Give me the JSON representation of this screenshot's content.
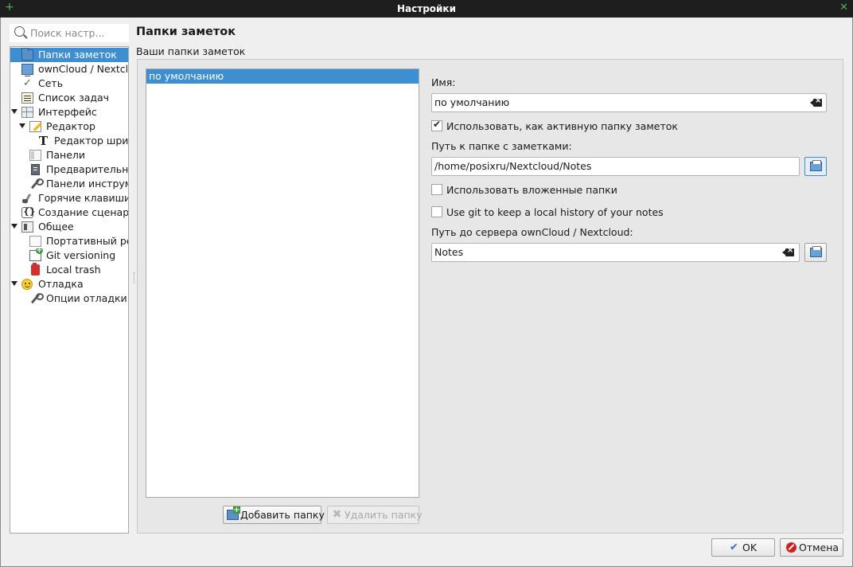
{
  "window": {
    "title": "Настройки"
  },
  "sidebar": {
    "search_placeholder": "Поиск настр...",
    "items": [
      {
        "label": "Папки заметок"
      },
      {
        "label": "ownCloud / Nextcloud"
      },
      {
        "label": "Сеть"
      },
      {
        "label": "Список задач"
      },
      {
        "label": "Интерфейс"
      },
      {
        "label": "Редактор"
      },
      {
        "label": "Редактор шрифтов"
      },
      {
        "label": "Панели"
      },
      {
        "label": "Предварительный просмотр"
      },
      {
        "label": "Панели инструментов"
      },
      {
        "label": "Горячие клавиши"
      },
      {
        "label": "Создание сценариев"
      },
      {
        "label": "Общее"
      },
      {
        "label": "Портативный режим"
      },
      {
        "label": "Git versioning"
      },
      {
        "label": "Local trash"
      },
      {
        "label": "Отладка"
      },
      {
        "label": "Опции отладки"
      }
    ]
  },
  "main": {
    "title": "Папки заметок",
    "group_label": "Ваши папки заметок",
    "folders": [
      {
        "name": "по умолчанию"
      }
    ],
    "add_button": "Добавить папку",
    "remove_button": "Удалить папку",
    "name_label": "Имя:",
    "name_value": "по умолчанию",
    "active_checkbox": "Использовать, как активную папку заметок",
    "path_label": "Путь к папке с заметками:",
    "path_value": "/home/posixru/Nextcloud/Notes",
    "subfolders_checkbox": "Использовать вложенные папки",
    "git_checkbox": "Use git to keep a local history of your notes",
    "server_path_label": "Путь до сервера ownCloud / Nextcloud:",
    "server_path_value": "Notes"
  },
  "footer": {
    "ok": "OK",
    "cancel": "Отмена"
  }
}
